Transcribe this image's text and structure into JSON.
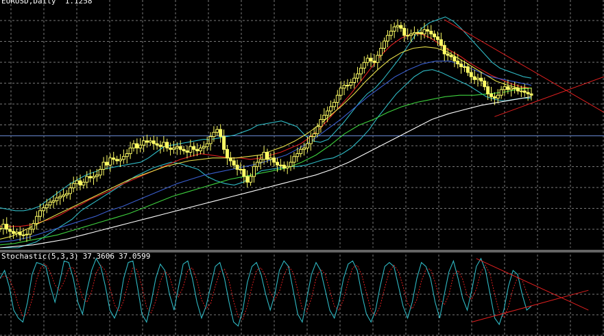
{
  "chart_data": [
    {
      "type": "candlestick",
      "title": "EURUSD,Daily  1.1258",
      "symbol": "EURUSD",
      "timeframe": "Daily",
      "price": "1.1258",
      "candle_up_color": "#ffff66",
      "candle_down_color": "#ffff66",
      "background": "#000000",
      "grid": true,
      "grid_color": "#8a8a8a",
      "horizontal_line": {
        "level": 0.785,
        "color": "#6a8bd6"
      },
      "closes": [
        0.135,
        0.165,
        0.13,
        0.115,
        0.1,
        0.11,
        0.09,
        0.09,
        0.095,
        0.13,
        0.17,
        0.22,
        0.26,
        0.28,
        0.3,
        0.32,
        0.33,
        0.35,
        0.36,
        0.37,
        0.38,
        0.42,
        0.45,
        0.47,
        0.44,
        0.46,
        0.5,
        0.49,
        0.5,
        0.51,
        0.55,
        0.6,
        0.58,
        0.63,
        0.62,
        0.61,
        0.62,
        0.64,
        0.66,
        0.7,
        0.73,
        0.7,
        0.72,
        0.75,
        0.74,
        0.75,
        0.73,
        0.72,
        0.71,
        0.74,
        0.7,
        0.69,
        0.7,
        0.71,
        0.69,
        0.68,
        0.67,
        0.71,
        0.69,
        0.68,
        0.7,
        0.71,
        0.73,
        0.78,
        0.81,
        0.83,
        0.78,
        0.69,
        0.63,
        0.61,
        0.58,
        0.55,
        0.55,
        0.5,
        0.46,
        0.5,
        0.57,
        0.6,
        0.62,
        0.67,
        0.62,
        0.63,
        0.6,
        0.58,
        0.58,
        0.56,
        0.57,
        0.6,
        0.64,
        0.66,
        0.69,
        0.7,
        0.73,
        0.78,
        0.8,
        0.85,
        0.9,
        0.93,
        0.96,
        0.99,
        1.02,
        1.07,
        1.12,
        1.14,
        1.14,
        1.16,
        1.19,
        1.22,
        1.26,
        1.3,
        1.33,
        1.31,
        1.3,
        1.35,
        1.4,
        1.45,
        1.49,
        1.52,
        1.55,
        1.56,
        1.54,
        1.49,
        1.49,
        1.5,
        1.51,
        1.51,
        1.5,
        1.53,
        1.52,
        1.5,
        1.48,
        1.46,
        1.42,
        1.36,
        1.35,
        1.34,
        1.31,
        1.29,
        1.27,
        1.27,
        1.23,
        1.2,
        1.18,
        1.19,
        1.17,
        1.13,
        1.08,
        1.06,
        1.05,
        1.07,
        1.11,
        1.13,
        1.11,
        1.12,
        1.12,
        1.1,
        1.1,
        1.09,
        1.08,
        1.07
      ],
      "indicators": [
        {
          "type": "bollinger",
          "color": "#2fb9c4",
          "values": [
            0.28,
            0.27,
            0.26,
            0.26,
            0.27,
            0.29,
            0.33,
            0.37,
            0.41,
            0.45,
            0.48,
            0.51,
            0.53,
            0.55,
            0.56,
            0.57,
            0.58,
            0.59,
            0.6,
            0.63,
            0.67,
            0.71,
            0.72,
            0.73,
            0.74,
            0.75,
            0.76,
            0.76,
            0.77,
            0.78,
            0.79,
            0.81,
            0.83,
            0.86,
            0.87,
            0.88,
            0.89,
            0.87,
            0.85,
            0.79,
            0.75,
            0.74,
            0.76,
            0.82,
            0.88,
            0.95,
            1.02,
            1.08,
            1.12,
            1.18,
            1.25,
            1.32,
            1.4,
            1.48,
            1.54,
            1.58,
            1.6,
            1.62,
            1.59,
            1.54,
            1.48,
            1.42,
            1.36,
            1.3,
            1.26,
            1.24,
            1.22,
            1.2,
            1.19
          ]
        },
        {
          "type": "bollinger",
          "color": "#2fb9c4",
          "values": [
            0.0,
            0.0,
            0.0,
            0.02,
            0.04,
            0.08,
            0.12,
            0.16,
            0.2,
            0.26,
            0.3,
            0.34,
            0.38,
            0.42,
            0.46,
            0.5,
            0.53,
            0.56,
            0.58,
            0.6,
            0.59,
            0.57,
            0.55,
            0.5,
            0.47,
            0.45,
            0.44,
            0.46,
            0.5,
            0.54,
            0.55,
            0.56,
            0.57,
            0.57,
            0.58,
            0.6,
            0.62,
            0.63,
            0.66,
            0.7,
            0.76,
            0.83,
            0.92,
            1.0,
            1.08,
            1.14,
            1.2,
            1.24,
            1.25,
            1.23,
            1.2,
            1.17,
            1.14,
            1.1,
            1.06,
            1.04,
            1.03,
            1.04,
            1.05,
            1.05
          ]
        },
        {
          "type": "ma",
          "color": "#e02020",
          "values": [
            0.15,
            0.15,
            0.15,
            0.16,
            0.18,
            0.2,
            0.23,
            0.27,
            0.3,
            0.34,
            0.37,
            0.4,
            0.44,
            0.47,
            0.5,
            0.53,
            0.56,
            0.59,
            0.62,
            0.64,
            0.66,
            0.65,
            0.64,
            0.63,
            0.63,
            0.62,
            0.63,
            0.65,
            0.67,
            0.7,
            0.73,
            0.78,
            0.84,
            0.92,
            1.0,
            1.08,
            1.17,
            1.26,
            1.35,
            1.42,
            1.47,
            1.5,
            1.5,
            1.47,
            1.42,
            1.38,
            1.34,
            1.29,
            1.25,
            1.21,
            1.18,
            1.15,
            1.13,
            1.12
          ]
        },
        {
          "type": "ma",
          "color": "#e8e04a",
          "values": [
            0.06,
            0.08,
            0.12,
            0.16,
            0.2,
            0.24,
            0.28,
            0.32,
            0.36,
            0.4,
            0.44,
            0.48,
            0.51,
            0.54,
            0.57,
            0.59,
            0.61,
            0.62,
            0.63,
            0.63,
            0.63,
            0.64,
            0.65,
            0.68,
            0.71,
            0.75,
            0.8,
            0.86,
            0.93,
            1.0,
            1.08,
            1.17,
            1.25,
            1.32,
            1.37,
            1.4,
            1.41,
            1.4,
            1.37,
            1.32,
            1.27,
            1.22,
            1.17,
            1.14,
            1.12,
            1.12
          ]
        },
        {
          "type": "ma",
          "color": "#3a5fd0",
          "values": [
            0.04,
            0.05,
            0.07,
            0.1,
            0.13,
            0.16,
            0.19,
            0.22,
            0.26,
            0.29,
            0.33,
            0.37,
            0.41,
            0.45,
            0.48,
            0.51,
            0.53,
            0.55,
            0.57,
            0.59,
            0.62,
            0.65,
            0.7,
            0.76,
            0.83,
            0.9,
            0.98,
            1.06,
            1.13,
            1.2,
            1.25,
            1.29,
            1.31,
            1.31,
            1.28,
            1.24,
            1.2,
            1.18,
            1.16,
            1.14
          ]
        },
        {
          "type": "ma",
          "color": "#3fd43f",
          "values": [
            0.02,
            0.03,
            0.05,
            0.07,
            0.09,
            0.12,
            0.15,
            0.18,
            0.21,
            0.24,
            0.28,
            0.32,
            0.36,
            0.39,
            0.42,
            0.45,
            0.48,
            0.5,
            0.52,
            0.54,
            0.56,
            0.6,
            0.65,
            0.72,
            0.8,
            0.86,
            0.9,
            0.95,
            0.99,
            1.02,
            1.04,
            1.06,
            1.07,
            1.07,
            1.08,
            1.09,
            1.11,
            1.12
          ]
        },
        {
          "type": "ma",
          "color": "#ffffff",
          "values": [
            0.0,
            0.01,
            0.02,
            0.04,
            0.06,
            0.09,
            0.12,
            0.15,
            0.18,
            0.21,
            0.24,
            0.27,
            0.3,
            0.33,
            0.36,
            0.39,
            0.42,
            0.45,
            0.48,
            0.51,
            0.55,
            0.6,
            0.66,
            0.72,
            0.78,
            0.84,
            0.9,
            0.94,
            0.97,
            1.0,
            1.02,
            1.04,
            1.06
          ]
        }
      ],
      "trendlines": [
        {
          "color": "#e02020",
          "from": [
            133,
            1.6
          ],
          "to": [
            200,
            0.95
          ]
        },
        {
          "color": "#e02020",
          "from": [
            148,
            0.92
          ],
          "to": [
            200,
            1.2
          ]
        }
      ]
    },
    {
      "type": "line",
      "title": "Stochastic(5,3,3)",
      "values_text": [
        "37.3606",
        "37.0599"
      ],
      "main_color": "#2fb9c4",
      "signal_color": "#e02020",
      "grid": true,
      "ylim": [
        0,
        100
      ],
      "main": [
        70,
        80,
        60,
        30,
        20,
        15,
        40,
        75,
        90,
        88,
        85,
        60,
        40,
        65,
        92,
        90,
        70,
        40,
        25,
        55,
        80,
        95,
        85,
        60,
        30,
        20,
        35,
        70,
        90,
        92,
        60,
        25,
        15,
        40,
        70,
        88,
        80,
        50,
        30,
        60,
        88,
        92,
        70,
        40,
        20,
        35,
        60,
        85,
        90,
        70,
        40,
        15,
        10,
        30,
        65,
        85,
        90,
        75,
        50,
        30,
        50,
        80,
        92,
        85,
        55,
        25,
        15,
        45,
        75,
        90,
        80,
        55,
        30,
        20,
        40,
        70,
        88,
        92,
        80,
        50,
        25,
        15,
        30,
        60,
        85,
        90,
        85,
        60,
        35,
        20,
        40,
        70,
        90,
        85,
        70,
        40,
        20,
        50,
        78,
        92,
        70,
        45,
        30,
        55,
        85,
        95,
        80,
        50,
        20,
        12,
        30,
        60,
        80,
        75,
        50,
        30,
        35
      ],
      "trendlines": [
        {
          "color": "#e02020",
          "from": [
            98,
            95
          ],
          "to": [
            115,
            30
          ]
        },
        {
          "color": "#e02020",
          "from": [
            97,
            15
          ],
          "to": [
            115,
            55
          ]
        }
      ]
    }
  ]
}
